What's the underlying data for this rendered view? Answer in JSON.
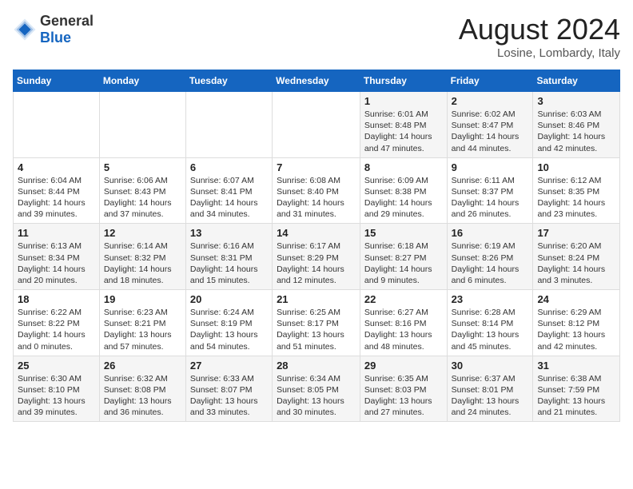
{
  "header": {
    "logo_general": "General",
    "logo_blue": "Blue",
    "month_title": "August 2024",
    "location": "Losine, Lombardy, Italy"
  },
  "days_of_week": [
    "Sunday",
    "Monday",
    "Tuesday",
    "Wednesday",
    "Thursday",
    "Friday",
    "Saturday"
  ],
  "weeks": [
    [
      {
        "day": "",
        "info": ""
      },
      {
        "day": "",
        "info": ""
      },
      {
        "day": "",
        "info": ""
      },
      {
        "day": "",
        "info": ""
      },
      {
        "day": "1",
        "info": "Sunrise: 6:01 AM\nSunset: 8:48 PM\nDaylight: 14 hours\nand 47 minutes."
      },
      {
        "day": "2",
        "info": "Sunrise: 6:02 AM\nSunset: 8:47 PM\nDaylight: 14 hours\nand 44 minutes."
      },
      {
        "day": "3",
        "info": "Sunrise: 6:03 AM\nSunset: 8:46 PM\nDaylight: 14 hours\nand 42 minutes."
      }
    ],
    [
      {
        "day": "4",
        "info": "Sunrise: 6:04 AM\nSunset: 8:44 PM\nDaylight: 14 hours\nand 39 minutes."
      },
      {
        "day": "5",
        "info": "Sunrise: 6:06 AM\nSunset: 8:43 PM\nDaylight: 14 hours\nand 37 minutes."
      },
      {
        "day": "6",
        "info": "Sunrise: 6:07 AM\nSunset: 8:41 PM\nDaylight: 14 hours\nand 34 minutes."
      },
      {
        "day": "7",
        "info": "Sunrise: 6:08 AM\nSunset: 8:40 PM\nDaylight: 14 hours\nand 31 minutes."
      },
      {
        "day": "8",
        "info": "Sunrise: 6:09 AM\nSunset: 8:38 PM\nDaylight: 14 hours\nand 29 minutes."
      },
      {
        "day": "9",
        "info": "Sunrise: 6:11 AM\nSunset: 8:37 PM\nDaylight: 14 hours\nand 26 minutes."
      },
      {
        "day": "10",
        "info": "Sunrise: 6:12 AM\nSunset: 8:35 PM\nDaylight: 14 hours\nand 23 minutes."
      }
    ],
    [
      {
        "day": "11",
        "info": "Sunrise: 6:13 AM\nSunset: 8:34 PM\nDaylight: 14 hours\nand 20 minutes."
      },
      {
        "day": "12",
        "info": "Sunrise: 6:14 AM\nSunset: 8:32 PM\nDaylight: 14 hours\nand 18 minutes."
      },
      {
        "day": "13",
        "info": "Sunrise: 6:16 AM\nSunset: 8:31 PM\nDaylight: 14 hours\nand 15 minutes."
      },
      {
        "day": "14",
        "info": "Sunrise: 6:17 AM\nSunset: 8:29 PM\nDaylight: 14 hours\nand 12 minutes."
      },
      {
        "day": "15",
        "info": "Sunrise: 6:18 AM\nSunset: 8:27 PM\nDaylight: 14 hours\nand 9 minutes."
      },
      {
        "day": "16",
        "info": "Sunrise: 6:19 AM\nSunset: 8:26 PM\nDaylight: 14 hours\nand 6 minutes."
      },
      {
        "day": "17",
        "info": "Sunrise: 6:20 AM\nSunset: 8:24 PM\nDaylight: 14 hours\nand 3 minutes."
      }
    ],
    [
      {
        "day": "18",
        "info": "Sunrise: 6:22 AM\nSunset: 8:22 PM\nDaylight: 14 hours\nand 0 minutes."
      },
      {
        "day": "19",
        "info": "Sunrise: 6:23 AM\nSunset: 8:21 PM\nDaylight: 13 hours\nand 57 minutes."
      },
      {
        "day": "20",
        "info": "Sunrise: 6:24 AM\nSunset: 8:19 PM\nDaylight: 13 hours\nand 54 minutes."
      },
      {
        "day": "21",
        "info": "Sunrise: 6:25 AM\nSunset: 8:17 PM\nDaylight: 13 hours\nand 51 minutes."
      },
      {
        "day": "22",
        "info": "Sunrise: 6:27 AM\nSunset: 8:16 PM\nDaylight: 13 hours\nand 48 minutes."
      },
      {
        "day": "23",
        "info": "Sunrise: 6:28 AM\nSunset: 8:14 PM\nDaylight: 13 hours\nand 45 minutes."
      },
      {
        "day": "24",
        "info": "Sunrise: 6:29 AM\nSunset: 8:12 PM\nDaylight: 13 hours\nand 42 minutes."
      }
    ],
    [
      {
        "day": "25",
        "info": "Sunrise: 6:30 AM\nSunset: 8:10 PM\nDaylight: 13 hours\nand 39 minutes."
      },
      {
        "day": "26",
        "info": "Sunrise: 6:32 AM\nSunset: 8:08 PM\nDaylight: 13 hours\nand 36 minutes."
      },
      {
        "day": "27",
        "info": "Sunrise: 6:33 AM\nSunset: 8:07 PM\nDaylight: 13 hours\nand 33 minutes."
      },
      {
        "day": "28",
        "info": "Sunrise: 6:34 AM\nSunset: 8:05 PM\nDaylight: 13 hours\nand 30 minutes."
      },
      {
        "day": "29",
        "info": "Sunrise: 6:35 AM\nSunset: 8:03 PM\nDaylight: 13 hours\nand 27 minutes."
      },
      {
        "day": "30",
        "info": "Sunrise: 6:37 AM\nSunset: 8:01 PM\nDaylight: 13 hours\nand 24 minutes."
      },
      {
        "day": "31",
        "info": "Sunrise: 6:38 AM\nSunset: 7:59 PM\nDaylight: 13 hours\nand 21 minutes."
      }
    ]
  ]
}
